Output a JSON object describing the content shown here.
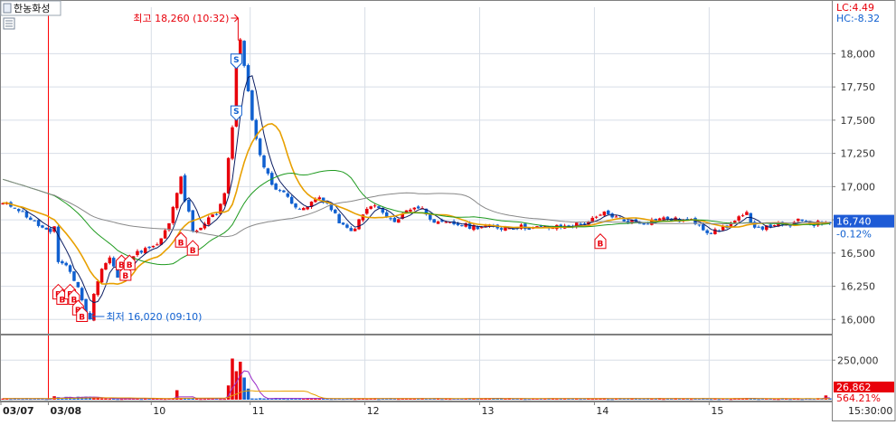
{
  "chart_data": {
    "type": "line",
    "title": "한농화성",
    "indicator_labels": {
      "lc": "LC:4.49",
      "hc": "HC:-8.32"
    },
    "price_axis": {
      "ticks": [
        "18,000",
        "17,750",
        "17,500",
        "17,250",
        "17,000",
        "16,750",
        "16,500",
        "16,250",
        "16,000"
      ],
      "tick_values": [
        18000,
        17750,
        17500,
        17250,
        17000,
        16750,
        16500,
        16250,
        16000
      ],
      "ylim": [
        15900,
        18350
      ]
    },
    "volume_axis": {
      "ticks": [
        "250,000"
      ],
      "tick_values": [
        250000
      ],
      "ylim": [
        0,
        400000
      ]
    },
    "x_axis": {
      "labels": [
        "03/07",
        "03/08",
        "10",
        "11",
        "12",
        "13",
        "14",
        "15",
        "15:30:00"
      ],
      "label_index": [
        0,
        12,
        38,
        63,
        92,
        121,
        150,
        179,
        209
      ],
      "n_bars": 210
    },
    "current": {
      "price_label": "16,740",
      "change_label": "-0.12%",
      "volume_label": "26,862",
      "volume_change_label": "564.21%"
    },
    "high_annotation": "최고 18,260 (10:32)",
    "low_annotation": "최저 16,020 (09:10)",
    "buy_signals": [
      {
        "label": "B",
        "i": 14,
        "price": 16250
      },
      {
        "label": "B",
        "i": 15,
        "price": 16210
      },
      {
        "label": "B",
        "i": 17,
        "price": 16250
      },
      {
        "label": "B",
        "i": 18,
        "price": 16210
      },
      {
        "label": "B",
        "i": 19,
        "price": 16130
      },
      {
        "label": "B",
        "i": 20,
        "price": 16080
      },
      {
        "label": "B",
        "i": 30,
        "price": 16470
      },
      {
        "label": "B",
        "i": 31,
        "price": 16390
      },
      {
        "label": "B",
        "i": 32,
        "price": 16470
      },
      {
        "label": "B",
        "i": 45,
        "price": 16640
      },
      {
        "label": "B",
        "i": 48,
        "price": 16580
      },
      {
        "label": "B",
        "i": 151,
        "price": 16630
      }
    ],
    "sell_signals": [
      {
        "label": "S",
        "i": 59,
        "price": 17950
      },
      {
        "label": "S",
        "i": 59,
        "price": 17560
      }
    ],
    "colors": {
      "up": "#e8000b",
      "down": "#1060d0",
      "ma_short": "#0b1d63",
      "ma_mid": "#e8a000",
      "ma_long": "#1e9a1e",
      "ma_xlong": "#888888",
      "volume_ma": "#9b2cc9",
      "grid": "#d7dde6",
      "price_box": "#1e5bd6",
      "volume_box": "#e8000b",
      "vline": "#ff0000"
    }
  }
}
